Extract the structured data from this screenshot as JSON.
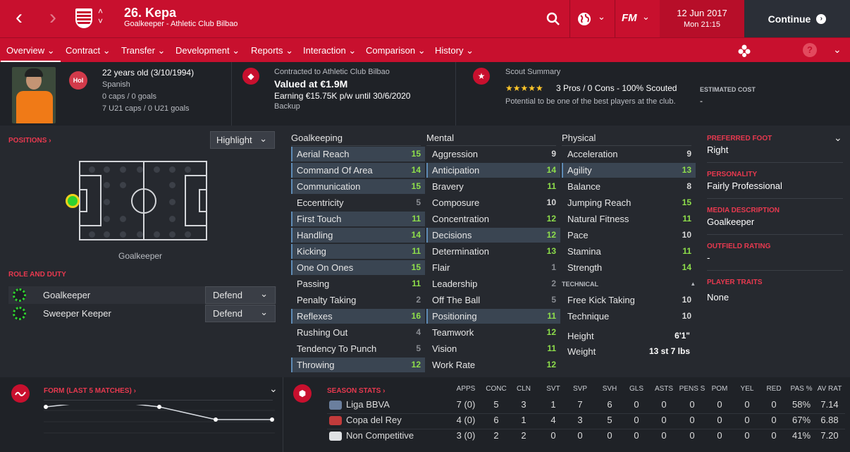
{
  "header": {
    "back_icon": "chevron-left-icon",
    "forward_icon": "chevron-right-icon",
    "player_title": "26. Kepa",
    "player_subtitle": "Goalkeeper - Athletic Club Bilbao",
    "date": "12 Jun 2017",
    "time": "Mon 21:15",
    "continue_label": "Continue",
    "fm_label": "FM"
  },
  "menu": {
    "items": [
      "Overview",
      "Contract",
      "Transfer",
      "Development",
      "Reports",
      "Interaction",
      "Comparison",
      "History"
    ],
    "help_label": "?"
  },
  "info": {
    "nationality_badge": "Hol",
    "age": "22 years old (3/10/1994)",
    "nationality": "Spanish",
    "caps": "0 caps / 0 goals",
    "u21_caps": "7 U21 caps / 0 U21 goals",
    "contracted": "Contracted to Athletic Club Bilbao",
    "valued": "Valued at €1.9M",
    "earning": "Earning €15.75K p/w until 30/6/2020",
    "squad_status": "Backup",
    "scout_title": "Scout Summary",
    "scout_rating_stars": 5,
    "scout_line": "3 Pros / 0 Cons - 100% Scouted",
    "potential": "Potential to be one of the best players at the club.",
    "estimated_cost_label": "ESTIMATED COST",
    "estimated_cost_value": "-"
  },
  "positions": {
    "label": "POSITIONS",
    "highlight_select": "Highlight",
    "position_caption": "Goalkeeper",
    "role_duty_label": "ROLE AND DUTY",
    "roles": [
      {
        "name": "Goalkeeper",
        "duty": "Defend"
      },
      {
        "name": "Sweeper Keeper",
        "duty": "Defend"
      }
    ]
  },
  "attributes": {
    "goalkeeping_title": "Goalkeeping",
    "mental_title": "Mental",
    "physical_title": "Physical",
    "technical_title": "TECHNICAL",
    "goalkeeping": [
      {
        "name": "Aerial Reach",
        "value": "15",
        "hl": true
      },
      {
        "name": "Command Of Area",
        "value": "14",
        "hl": true
      },
      {
        "name": "Communication",
        "value": "15",
        "hl": true
      },
      {
        "name": "Eccentricity",
        "value": "5",
        "hl": false
      },
      {
        "name": "First Touch",
        "value": "11",
        "hl": true
      },
      {
        "name": "Handling",
        "value": "14",
        "hl": true
      },
      {
        "name": "Kicking",
        "value": "11",
        "hl": true
      },
      {
        "name": "One On Ones",
        "value": "15",
        "hl": true
      },
      {
        "name": "Passing",
        "value": "11",
        "hl": false
      },
      {
        "name": "Penalty Taking",
        "value": "2",
        "hl": false
      },
      {
        "name": "Reflexes",
        "value": "16",
        "hl": true
      },
      {
        "name": "Rushing Out",
        "value": "4",
        "hl": false
      },
      {
        "name": "Tendency To Punch",
        "value": "5",
        "hl": false
      },
      {
        "name": "Throwing",
        "value": "12",
        "hl": true
      }
    ],
    "mental": [
      {
        "name": "Aggression",
        "value": "9",
        "hl": false
      },
      {
        "name": "Anticipation",
        "value": "14",
        "hl": true
      },
      {
        "name": "Bravery",
        "value": "11",
        "hl": false
      },
      {
        "name": "Composure",
        "value": "10",
        "hl": false
      },
      {
        "name": "Concentration",
        "value": "12",
        "hl": false
      },
      {
        "name": "Decisions",
        "value": "12",
        "hl": true
      },
      {
        "name": "Determination",
        "value": "13",
        "hl": false
      },
      {
        "name": "Flair",
        "value": "1",
        "hl": false
      },
      {
        "name": "Leadership",
        "value": "2",
        "hl": false
      },
      {
        "name": "Off The Ball",
        "value": "5",
        "hl": false
      },
      {
        "name": "Positioning",
        "value": "11",
        "hl": true
      },
      {
        "name": "Teamwork",
        "value": "12",
        "hl": false
      },
      {
        "name": "Vision",
        "value": "11",
        "hl": false
      },
      {
        "name": "Work Rate",
        "value": "12",
        "hl": false
      }
    ],
    "physical": [
      {
        "name": "Acceleration",
        "value": "9",
        "hl": false
      },
      {
        "name": "Agility",
        "value": "13",
        "hl": true
      },
      {
        "name": "Balance",
        "value": "8",
        "hl": false
      },
      {
        "name": "Jumping Reach",
        "value": "15",
        "hl": false
      },
      {
        "name": "Natural Fitness",
        "value": "11",
        "hl": false
      },
      {
        "name": "Pace",
        "value": "10",
        "hl": false
      },
      {
        "name": "Stamina",
        "value": "11",
        "hl": false
      },
      {
        "name": "Strength",
        "value": "14",
        "hl": false
      }
    ],
    "technical": [
      {
        "name": "Free Kick Taking",
        "value": "10",
        "hl": false
      },
      {
        "name": "Technique",
        "value": "10",
        "hl": false
      }
    ],
    "height_label": "Height",
    "height_value": "6'1\"",
    "weight_label": "Weight",
    "weight_value": "13 st 7 lbs"
  },
  "profile": {
    "preferred_foot_label": "PREFERRED FOOT",
    "preferred_foot": "Right",
    "personality_label": "PERSONALITY",
    "personality": "Fairly Professional",
    "media_label": "MEDIA DESCRIPTION",
    "media": "Goalkeeper",
    "outfield_label": "OUTFIELD RATING",
    "outfield": "-",
    "traits_label": "PLAYER TRAITS",
    "traits": "None"
  },
  "form": {
    "label": "FORM (LAST 5 MATCHES)",
    "ratings": [
      7.0,
      7.2,
      7.0,
      6.6,
      6.6
    ]
  },
  "season_stats": {
    "label": "SEASON STATS",
    "columns": [
      "APPS",
      "CONC",
      "CLN",
      "SVT",
      "SVP",
      "SVH",
      "GLS",
      "ASTS",
      "PENS S",
      "POM",
      "YEL",
      "RED",
      "PAS %",
      "AV RAT"
    ],
    "rows": [
      {
        "competition": "Liga BBVA",
        "values": [
          "7 (0)",
          "5",
          "3",
          "1",
          "7",
          "6",
          "0",
          "0",
          "0",
          "0",
          "0",
          "0",
          "58%",
          "7.14"
        ]
      },
      {
        "competition": "Copa del Rey",
        "values": [
          "4 (0)",
          "6",
          "1",
          "4",
          "3",
          "5",
          "0",
          "0",
          "0",
          "0",
          "0",
          "0",
          "67%",
          "6.88"
        ]
      },
      {
        "competition": "Non Competitive",
        "values": [
          "3 (0)",
          "2",
          "2",
          "0",
          "0",
          "0",
          "0",
          "0",
          "0",
          "0",
          "0",
          "0",
          "41%",
          "7.20"
        ]
      }
    ]
  },
  "colors": {
    "brand": "#c8102e",
    "good_value": "#8ede4b",
    "highlight_row": "#3a4552"
  }
}
